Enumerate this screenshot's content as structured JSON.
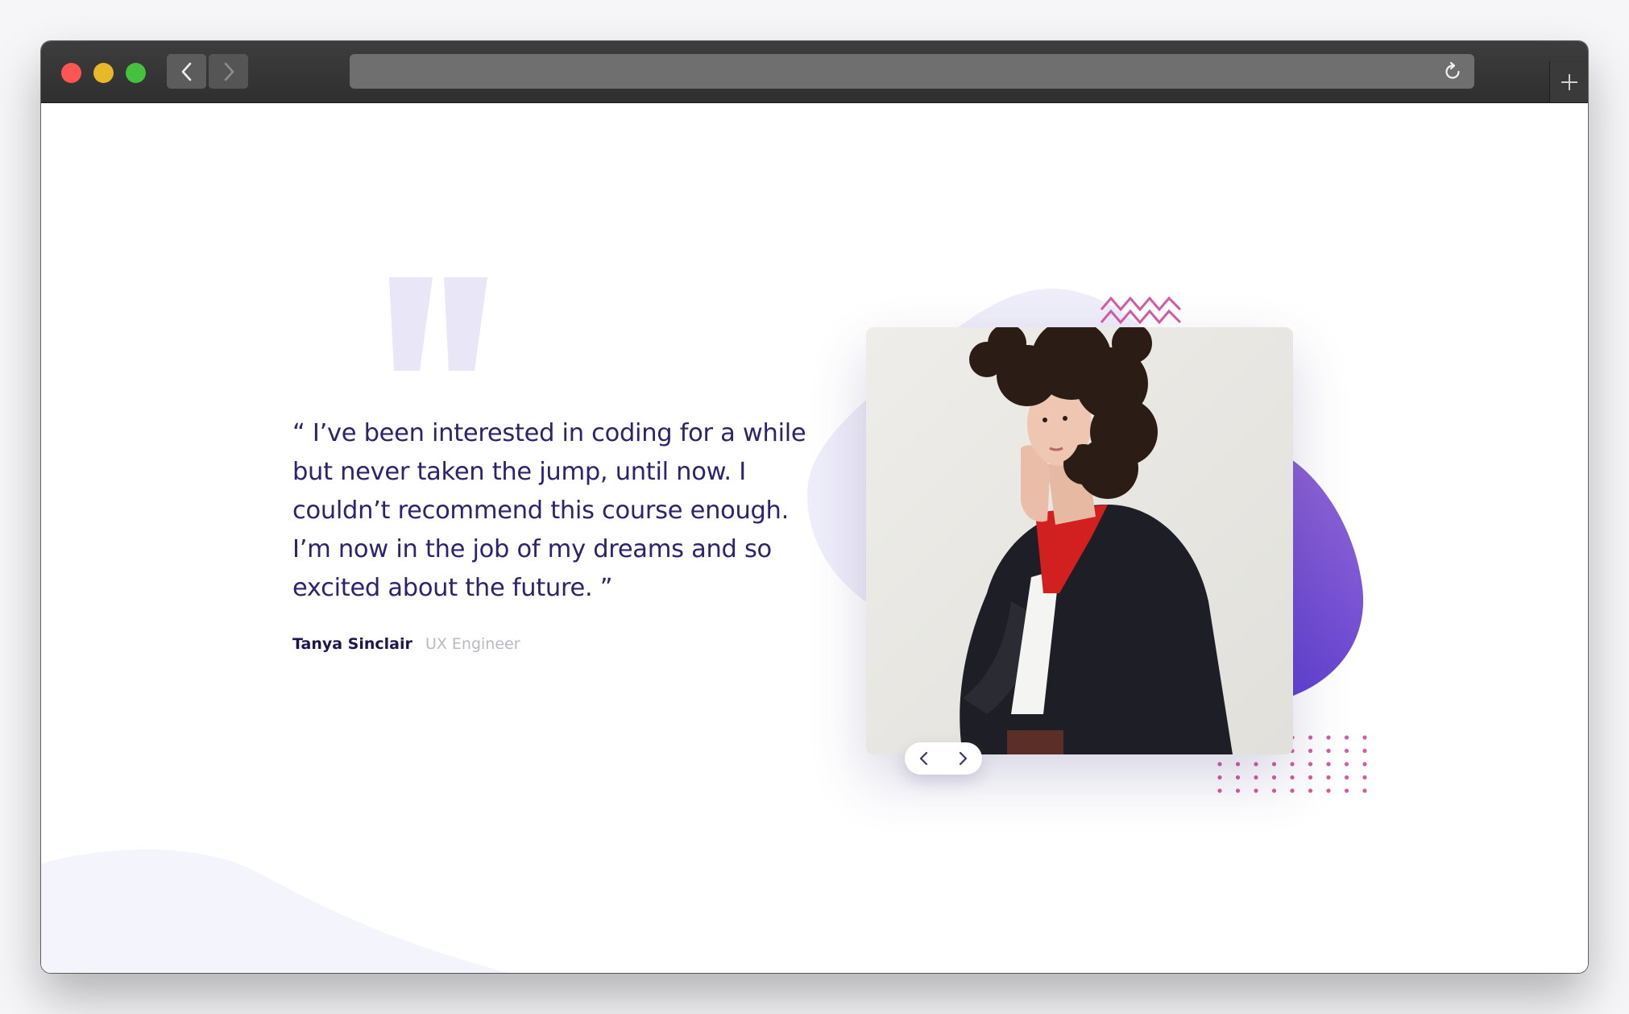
{
  "testimonial": {
    "quote": "“ I’ve been interested in coding for a while but never taken the jump, until now. I couldn’t recommend this course enough. I’m now in the job of my dreams and so excited about the future. ”",
    "author_name": "Tanya Sinclair",
    "author_role": "UX Engineer"
  },
  "icons": {
    "browser_back": "chevron-left-icon",
    "browser_forward": "chevron-right-icon",
    "reload": "reload-icon",
    "new_tab": "plus-icon",
    "quote_mark": "quote-mark-icon",
    "carousel_prev": "chevron-left-icon",
    "carousel_next": "chevron-right-icon"
  },
  "colors": {
    "text_dark_blue": "#2b236d",
    "author_name": "#1c1650",
    "author_role": "#b9b9c6",
    "quote_mark": "#e8e6f7",
    "blob_light": "#eeedf9",
    "gradient_purple_start": "#9569d5",
    "gradient_purple_end": "#4a2fd0",
    "accent_pink": "#d45ba4",
    "traffic_red": "#fd5552",
    "traffic_yellow": "#e7b829",
    "traffic_green": "#46c13d"
  }
}
